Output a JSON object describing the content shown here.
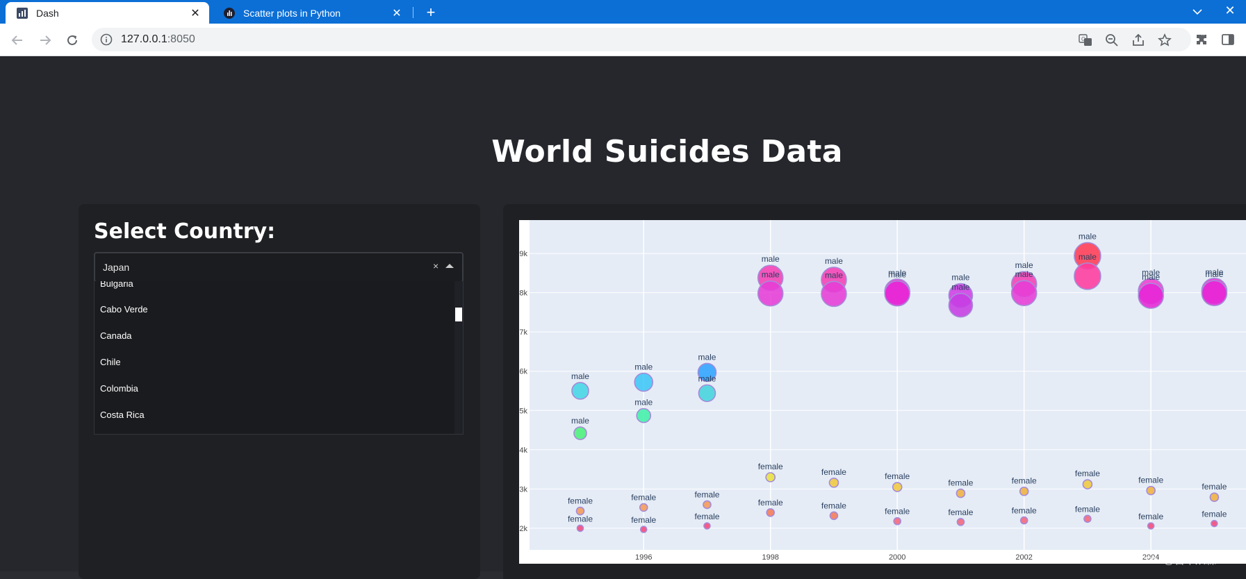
{
  "browser": {
    "tabs": [
      {
        "title": "Dash",
        "active": true,
        "favicon": "dash-icon"
      },
      {
        "title": "Scatter plots in Python",
        "active": false,
        "favicon": "plotly-icon"
      }
    ],
    "url_host": "127.0.0.1",
    "url_port": ":8050"
  },
  "page": {
    "title": "World Suicides Data",
    "select_label": "Select Country:",
    "dropdown": {
      "value": "Japan",
      "clear": "×",
      "options": [
        "Bulgaria",
        "Cabo Verde",
        "Canada",
        "Chile",
        "Colombia",
        "Costa Rica"
      ]
    }
  },
  "watermark": "CSDN @百木从森",
  "chart_data": {
    "type": "scatter",
    "title": "",
    "xlabel": "",
    "ylabel": "",
    "x_ticks": [
      1996,
      1998,
      2000,
      2002,
      2004
    ],
    "y_ticks": [
      2000,
      3000,
      4000,
      5000,
      6000,
      7000,
      8000,
      9000
    ],
    "y_tick_labels": [
      "2k",
      "3k",
      "4k",
      "5k",
      "6k",
      "7k",
      "8k",
      "9k"
    ],
    "xlim": [
      1994.2,
      2005.5
    ],
    "ylim": [
      1450,
      9850
    ],
    "point_text": [
      "male",
      "female"
    ],
    "points": [
      {
        "x": 1995,
        "y": 5500,
        "label": "male",
        "color": "#45d6e6",
        "size": 24
      },
      {
        "x": 1995,
        "y": 4420,
        "label": "male",
        "color": "#4cf07a",
        "size": 18
      },
      {
        "x": 1996,
        "y": 5720,
        "label": "male",
        "color": "#3ec7f7",
        "size": 26
      },
      {
        "x": 1996,
        "y": 4870,
        "label": "male",
        "color": "#42f0a8",
        "size": 20
      },
      {
        "x": 1997,
        "y": 5970,
        "label": "male",
        "color": "#2fa3ff",
        "size": 26
      },
      {
        "x": 1997,
        "y": 5440,
        "label": "male",
        "color": "#46d4de",
        "size": 24
      },
      {
        "x": 1998,
        "y": 8380,
        "label": "male",
        "color": "#f540b5",
        "size": 36
      },
      {
        "x": 1998,
        "y": 7980,
        "label": "male",
        "color": "#e63ed6",
        "size": 36
      },
      {
        "x": 1999,
        "y": 8330,
        "label": "male",
        "color": "#f540b5",
        "size": 36
      },
      {
        "x": 1999,
        "y": 7970,
        "label": "male",
        "color": "#e63ed6",
        "size": 36
      },
      {
        "x": 2000,
        "y": 8030,
        "label": "male",
        "color": "#ee2fd1",
        "size": 36
      },
      {
        "x": 2000,
        "y": 7980,
        "label": "male",
        "color": "#e626d6",
        "size": 36
      },
      {
        "x": 2001,
        "y": 7930,
        "label": "male",
        "color": "#cf3ee6",
        "size": 34
      },
      {
        "x": 2001,
        "y": 7680,
        "label": "male",
        "color": "#c63ee2",
        "size": 34
      },
      {
        "x": 2002,
        "y": 8220,
        "label": "male",
        "color": "#f540b5",
        "size": 36
      },
      {
        "x": 2002,
        "y": 7990,
        "label": "male",
        "color": "#e63ed6",
        "size": 36
      },
      {
        "x": 2003,
        "y": 8940,
        "label": "male",
        "color": "#ff3b55",
        "size": 38
      },
      {
        "x": 2003,
        "y": 8420,
        "label": "male",
        "color": "#ff3b9e",
        "size": 38
      },
      {
        "x": 2004,
        "y": 8040,
        "label": "male",
        "color": "#f03ed0",
        "size": 36
      },
      {
        "x": 2004,
        "y": 7920,
        "label": "male",
        "color": "#e626d6",
        "size": 36
      },
      {
        "x": 2005,
        "y": 8050,
        "label": "male",
        "color": "#ee2fd1",
        "size": 36
      },
      {
        "x": 2005,
        "y": 7990,
        "label": "male",
        "color": "#e626d6",
        "size": 36
      },
      {
        "x": 1995,
        "y": 2440,
        "label": "female",
        "color": "#f59a56",
        "size": 11
      },
      {
        "x": 1995,
        "y": 2000,
        "label": "female",
        "color": "#f5477a",
        "size": 9
      },
      {
        "x": 1996,
        "y": 2530,
        "label": "female",
        "color": "#f59a56",
        "size": 11
      },
      {
        "x": 1996,
        "y": 1970,
        "label": "female",
        "color": "#f5477a",
        "size": 9
      },
      {
        "x": 1997,
        "y": 2600,
        "label": "female",
        "color": "#f59a56",
        "size": 11
      },
      {
        "x": 1997,
        "y": 2060,
        "label": "female",
        "color": "#f5477a",
        "size": 9
      },
      {
        "x": 1998,
        "y": 3300,
        "label": "female",
        "color": "#e8e040",
        "size": 13
      },
      {
        "x": 1998,
        "y": 2400,
        "label": "female",
        "color": "#f57a56",
        "size": 11
      },
      {
        "x": 1999,
        "y": 3160,
        "label": "female",
        "color": "#f0c840",
        "size": 13
      },
      {
        "x": 1999,
        "y": 2320,
        "label": "female",
        "color": "#f57a56",
        "size": 11
      },
      {
        "x": 2000,
        "y": 3050,
        "label": "female",
        "color": "#f0c840",
        "size": 13
      },
      {
        "x": 2000,
        "y": 2180,
        "label": "female",
        "color": "#f5647a",
        "size": 10
      },
      {
        "x": 2001,
        "y": 2890,
        "label": "female",
        "color": "#f0b040",
        "size": 12
      },
      {
        "x": 2001,
        "y": 2160,
        "label": "female",
        "color": "#f5647a",
        "size": 10
      },
      {
        "x": 2002,
        "y": 2940,
        "label": "female",
        "color": "#f0b040",
        "size": 12
      },
      {
        "x": 2002,
        "y": 2200,
        "label": "female",
        "color": "#f5647a",
        "size": 10
      },
      {
        "x": 2003,
        "y": 3120,
        "label": "female",
        "color": "#f0c840",
        "size": 13
      },
      {
        "x": 2003,
        "y": 2240,
        "label": "female",
        "color": "#f5647a",
        "size": 10
      },
      {
        "x": 2004,
        "y": 2960,
        "label": "female",
        "color": "#f0b040",
        "size": 12
      },
      {
        "x": 2004,
        "y": 2060,
        "label": "female",
        "color": "#f5477a",
        "size": 9
      },
      {
        "x": 2005,
        "y": 2790,
        "label": "female",
        "color": "#f0b040",
        "size": 12
      },
      {
        "x": 2005,
        "y": 2120,
        "label": "female",
        "color": "#f5477a",
        "size": 9
      }
    ],
    "grid": true,
    "legend": "none",
    "colors": {
      "plot_bg": "#e5ecf6",
      "marker_line": "#a58bd8"
    }
  }
}
